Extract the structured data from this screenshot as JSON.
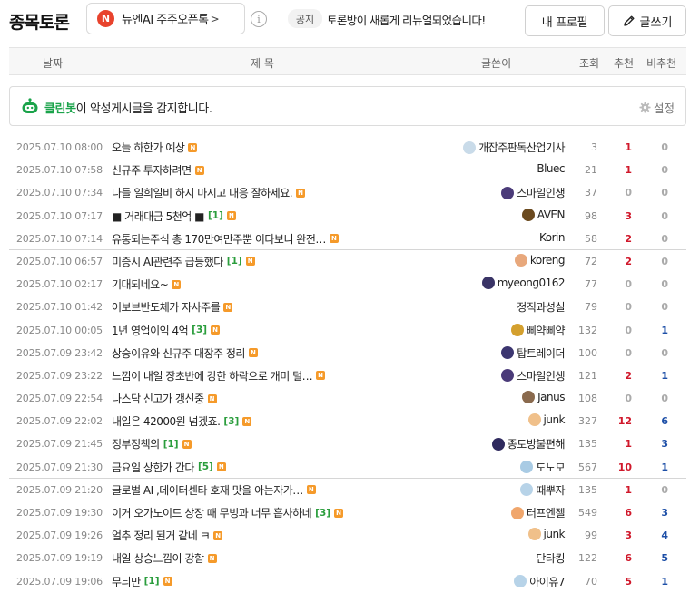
{
  "header": {
    "title": "종목토론",
    "stock_badge": "N",
    "stock_name": "뉴엔AI 주주오픈톡",
    "stock_arrow": ">",
    "info_glyph": "i",
    "notice_label": "공지",
    "notice_text": "토론방이 새롭게 리뉴얼되었습니다!",
    "profile_label": "내 프로필",
    "write_label": "글쓰기"
  },
  "columns": {
    "date": "날짜",
    "title": "제 목",
    "author": "글쓴이",
    "views": "조회",
    "up": "추천",
    "down": "비추천"
  },
  "cleanbot": {
    "brand": "클린봇",
    "text": "이 악성게시글을 감지합니다.",
    "settings_label": "설정"
  },
  "colors": {
    "up": "#d0182b",
    "down": "#1d4fa7",
    "zero": "#aaaaaa",
    "comment_count": "#2a9d3c",
    "new_badge": "#f59a2a",
    "cleanbot": "#1aa34a"
  },
  "new_mark": "N",
  "posts": [
    {
      "date": "2025.07.10 08:00",
      "title": "오늘 하한가 예상",
      "comments": "",
      "author": "개잡주판독산업기사",
      "avatar": "#c9dbe9",
      "views": "3",
      "up": "1",
      "down": "0"
    },
    {
      "date": "2025.07.10 07:58",
      "title": "신규주 투자하려면",
      "comments": "",
      "author": "Bluec",
      "avatar": "",
      "views": "21",
      "up": "1",
      "down": "0"
    },
    {
      "date": "2025.07.10 07:34",
      "title": "다들 일희일비 하지 마시고 대응 잘하세요.",
      "comments": "",
      "author": "스마일인생",
      "avatar": "#4b3b79",
      "views": "37",
      "up": "0",
      "down": "0"
    },
    {
      "date": "2025.07.10 07:17",
      "title": "■ 거래대금 5천억 ■",
      "comments": "[1]",
      "author": "AVEN",
      "avatar": "#6b4a1f",
      "views": "98",
      "up": "3",
      "down": "0"
    },
    {
      "date": "2025.07.10 07:14",
      "title": "유통되는주식 총 170만여만주뿐 이다보니 완전…",
      "comments": "",
      "author": "Korin",
      "avatar": "",
      "views": "58",
      "up": "2",
      "down": "0"
    },
    {
      "date": "2025.07.10 06:57",
      "title": "미증시 AI관련주 급등했다",
      "comments": "[1]",
      "author": "koreng",
      "avatar": "#e8a87c",
      "views": "72",
      "up": "2",
      "down": "0"
    },
    {
      "date": "2025.07.10 02:17",
      "title": "기대되네요~",
      "comments": "",
      "author": "myeong0162",
      "avatar": "#3a3466",
      "views": "77",
      "up": "0",
      "down": "0"
    },
    {
      "date": "2025.07.10 01:42",
      "title": "어보브반도체가 자사주를",
      "comments": "",
      "author": "정직과성실",
      "avatar": "",
      "views": "79",
      "up": "0",
      "down": "0"
    },
    {
      "date": "2025.07.10 00:05",
      "title": "1년 영업이익 4억",
      "comments": "[3]",
      "author": "삐약삐약",
      "avatar": "#d4a02e",
      "views": "132",
      "up": "0",
      "down": "1"
    },
    {
      "date": "2025.07.09 23:42",
      "title": "상승이유와 신규주 대장주 정리",
      "comments": "",
      "author": "탑트레이더",
      "avatar": "#3c3670",
      "views": "100",
      "up": "0",
      "down": "0"
    },
    {
      "date": "2025.07.09 23:22",
      "title": "느낌이 내일 장초반에 강한 하락으로 개미 털…",
      "comments": "",
      "author": "스마일인생",
      "avatar": "#4b3b79",
      "views": "121",
      "up": "2",
      "down": "1"
    },
    {
      "date": "2025.07.09 22:54",
      "title": "나스닥 신고가 갱신중",
      "comments": "",
      "author": "Janus",
      "avatar": "#8a6a4e",
      "views": "108",
      "up": "0",
      "down": "0"
    },
    {
      "date": "2025.07.09 22:02",
      "title": "내일은 42000원 넘겠죠.",
      "comments": "[3]",
      "author": "junk",
      "avatar": "#f0c08a",
      "views": "327",
      "up": "12",
      "down": "6"
    },
    {
      "date": "2025.07.09 21:45",
      "title": "정부정책의",
      "comments": "[1]",
      "author": "종토방불편해",
      "avatar": "#2f2a5e",
      "views": "135",
      "up": "1",
      "down": "3"
    },
    {
      "date": "2025.07.09 21:30",
      "title": "금요일 상한가 간다",
      "comments": "[5]",
      "author": "도노모",
      "avatar": "#a9cbe4",
      "views": "567",
      "up": "10",
      "down": "1"
    },
    {
      "date": "2025.07.09 21:20",
      "title": "글로벌 AI ,데이터센타 호재 맛을 아는자가…",
      "comments": "",
      "author": "때뿌자",
      "avatar": "#b7d3e8",
      "views": "135",
      "up": "1",
      "down": "0"
    },
    {
      "date": "2025.07.09 19:30",
      "title": "이거 오가노이드 상장 때 무빙과 너무 흡사하네",
      "comments": "[3]",
      "author": "터프엔젤",
      "avatar": "#f0a66c",
      "views": "549",
      "up": "6",
      "down": "3"
    },
    {
      "date": "2025.07.09 19:26",
      "title": "얼추 정리 된거 같네 ㅋ",
      "comments": "",
      "author": "junk",
      "avatar": "#f0c08a",
      "views": "99",
      "up": "3",
      "down": "4"
    },
    {
      "date": "2025.07.09 19:19",
      "title": "내일 상승느낌이 강함",
      "comments": "",
      "author": "단타킹",
      "avatar": "",
      "views": "122",
      "up": "6",
      "down": "5"
    },
    {
      "date": "2025.07.09 19:06",
      "title": "무늬만",
      "comments": "[1]",
      "author": "아이유7",
      "avatar": "#b7d3e8",
      "views": "70",
      "up": "5",
      "down": "1"
    }
  ]
}
